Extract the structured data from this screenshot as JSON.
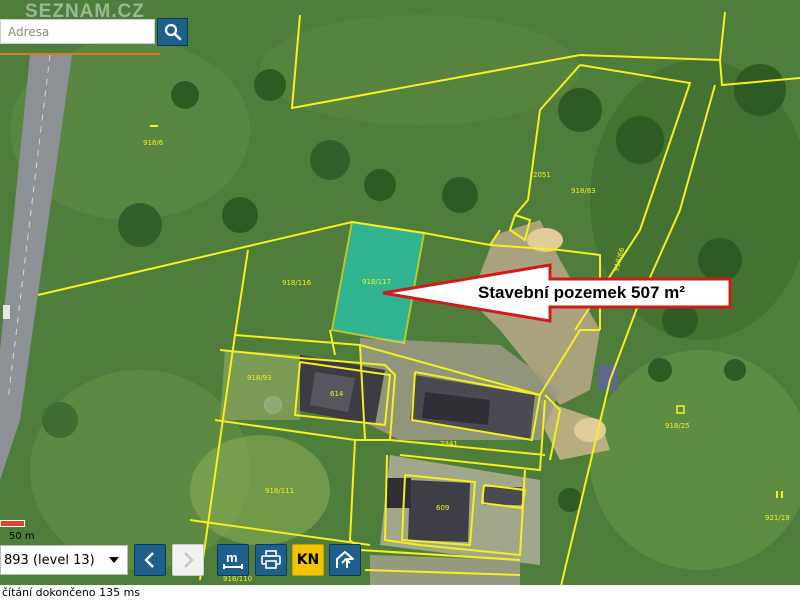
{
  "search": {
    "placeholder": "Adresa"
  },
  "logo_text": "SEZNAM.CZ",
  "map": {
    "parcel_labels": [
      "918/6",
      "918/83",
      "918/116",
      "918/117",
      "918/93",
      "918/25",
      "918/111",
      "918/110",
      "921/19",
      "2051",
      "918/66",
      "614",
      "609",
      "2341"
    ],
    "callout": "Stavební pozemek 507 m²",
    "highlight_color": "#1fd1c0",
    "boundary_color": "#f5ef1f",
    "callout_arrow_color": "#d11b1b"
  },
  "scale": {
    "label": "50 m"
  },
  "controls": {
    "level_select": "893 (level 13)",
    "kn_label": "KN"
  },
  "status": "čítání dokončeno 135 ms"
}
